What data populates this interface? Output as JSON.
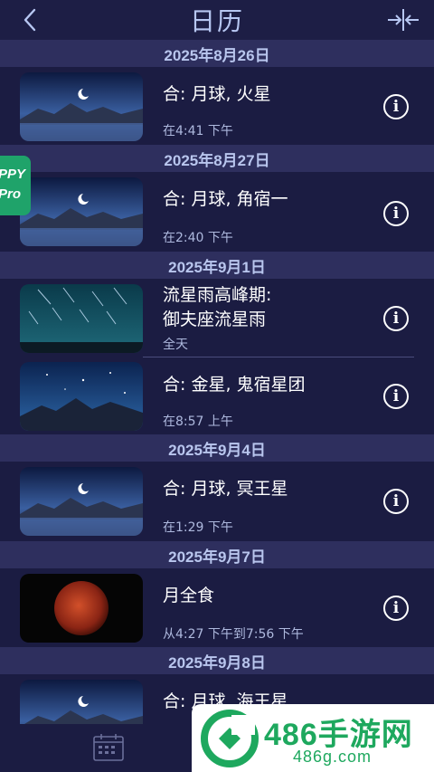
{
  "header": {
    "title": "日历"
  },
  "sections": [
    {
      "date": "2025年8月26日"
    },
    {
      "date": "2025年8月27日"
    },
    {
      "date": "2025年9月1日"
    },
    {
      "date": "2025年9月4日"
    },
    {
      "date": "2025年9月7日"
    },
    {
      "date": "2025年9月8日"
    }
  ],
  "events": [
    {
      "title": "合: 月球, 火星",
      "time": "在4:41 下午",
      "thumb": "moon-lake"
    },
    {
      "title": "合: 月球, 角宿一",
      "time": "在2:40 下午",
      "thumb": "moon-lake"
    },
    {
      "title": "流星雨高峰期:",
      "title2": "御夫座流星雨",
      "time": "全天",
      "thumb": "meteor-shower"
    },
    {
      "title": "合: 金星, 鬼宿星团",
      "time": "在8:57 上午",
      "thumb": "starry-mountains"
    },
    {
      "title": "合: 月球, 冥王星",
      "time": "在1:29 下午",
      "thumb": "moon-lake"
    },
    {
      "title": "月全食",
      "time": "从4:27 下午到7:56 下午",
      "thumb": "blood-moon"
    },
    {
      "title": "合: 月球, 海王星",
      "time": "",
      "thumb": "moon-lake"
    }
  ],
  "promo": {
    "line1": "PPY",
    "line2": "Pro"
  },
  "watermark": {
    "main": "486手游网",
    "sub": "486g.com"
  },
  "icons": {
    "back": "chevron-left-icon",
    "collapse": "collapse-arrows-icon",
    "info": "info-icon",
    "calendar": "calendar-icon"
  },
  "colors": {
    "background": "#1b1c42",
    "date_header_bg": "#2e2f5e",
    "date_header_text": "#b9c6ee",
    "title_text": "#b7c7f2",
    "subtext": "#aeb9de",
    "watermark_green": "#1ea85e"
  }
}
